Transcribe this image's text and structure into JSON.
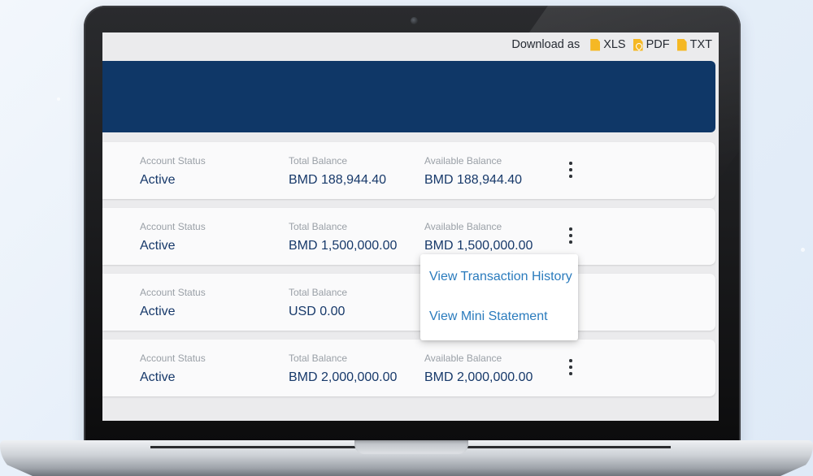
{
  "download": {
    "label": "Download as",
    "options": [
      {
        "label": "XLS",
        "icon": "xls-file-icon"
      },
      {
        "label": "PDF",
        "icon": "pdf-file-icon"
      },
      {
        "label": "TXT",
        "icon": "txt-file-icon"
      }
    ]
  },
  "accounts": [
    {
      "status_label": "Account Status",
      "status": "Active",
      "total_label": "Total Balance",
      "total": "BMD 188,944.40",
      "available_label": "Available Balance",
      "available": "BMD 188,944.40"
    },
    {
      "status_label": "Account Status",
      "status": "Active",
      "total_label": "Total Balance",
      "total": "BMD 1,500,000.00",
      "available_label": "Available Balance",
      "available": "BMD 1,500,000.00"
    },
    {
      "status_label": "Account Status",
      "status": "Active",
      "total_label": "Total Balance",
      "total": "USD 0.00"
    },
    {
      "status_label": "Account Status",
      "status": "Active",
      "total_label": "Total Balance",
      "total": "BMD 2,000,000.00",
      "available_label": "Available Balance",
      "available": "BMD 2,000,000.00"
    }
  ],
  "context_menu": {
    "items": [
      "View Transaction History",
      "View Mini Statement"
    ]
  },
  "colors": {
    "banner": "#0f3767",
    "value_text": "#17396a",
    "menu_link": "#2a7bbd",
    "file_icon": "#f5b824"
  }
}
